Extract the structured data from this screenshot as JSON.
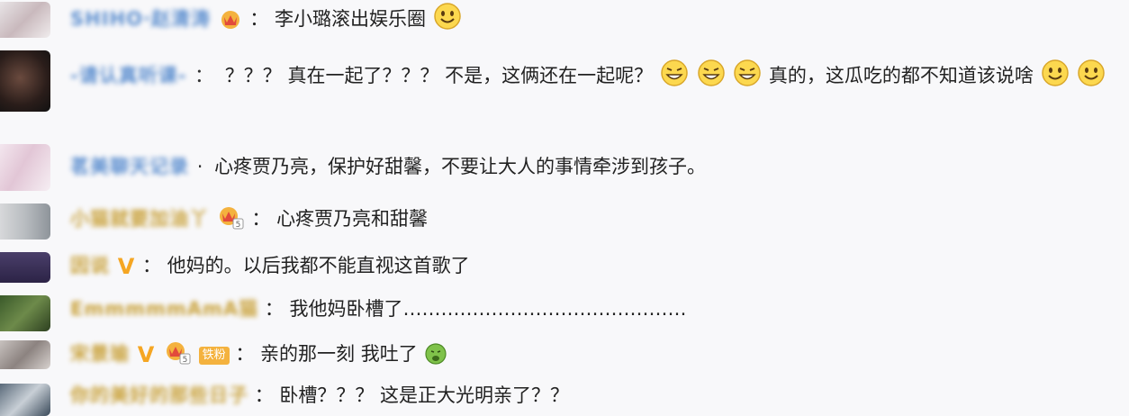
{
  "comments": [
    {
      "username": "SHIHO·赵清涛",
      "separator": "：",
      "text": "李小璐滚出娱乐圈"
    },
    {
      "username": "-请认真听课-",
      "separator": "：",
      "text": "？？？ 真在一起了？？？ 不是，这俩还在一起呢？",
      "text2": "真的，这瓜吃的都不知道该说啥"
    },
    {
      "username": "茗美聊天记录",
      "separator": "·",
      "text": "心疼贾乃亮，保护好甜馨，不要让大人的事情牵涉到孩子。"
    },
    {
      "username": "小猫就要加油丫",
      "separator": "：",
      "text": "心疼贾乃亮和甜馨"
    },
    {
      "username": "因说",
      "separator": "：",
      "text": "他妈的。以后我都不能直视这首歌了"
    },
    {
      "username": "EmmmmmAmA猫",
      "separator": "：",
      "text": "我他妈卧槽了………………………………………"
    },
    {
      "username": "宋景瑜",
      "separator": "：",
      "text": "亲的那一刻 我吐了",
      "fan_badge": "铁粉"
    },
    {
      "username": "你的美好的那些日子",
      "separator": "：",
      "text": "卧槽？？？ 这是正大光明亲了？？"
    }
  ],
  "badges": {
    "verified": "V",
    "level": "5"
  },
  "colors": {
    "username": "#5d8fcf",
    "badge": "#f5a623",
    "background": "#f8f8fa"
  },
  "icons": [
    "smile-emoji-icon",
    "grin-emoji-icon",
    "crown-icon",
    "vomit-emoji-icon"
  ]
}
